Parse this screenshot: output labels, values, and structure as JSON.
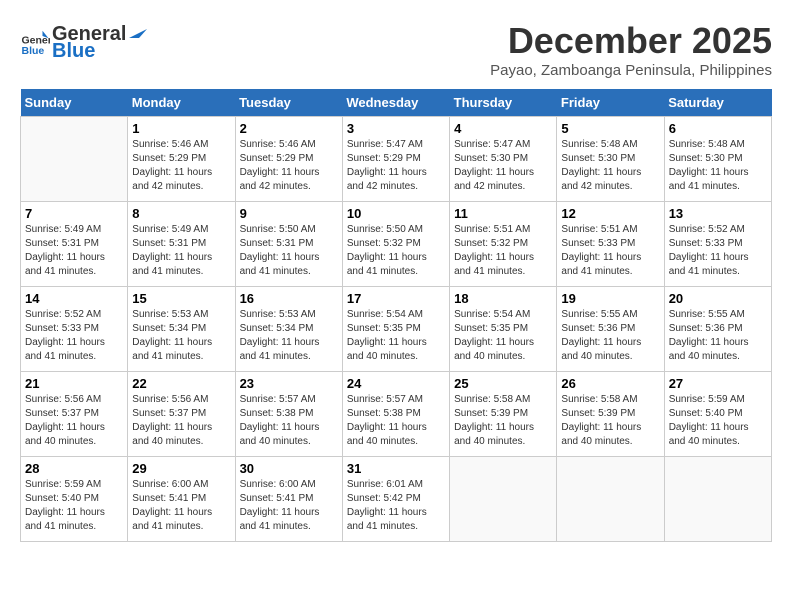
{
  "header": {
    "logo_general": "General",
    "logo_blue": "Blue",
    "month_year": "December 2025",
    "location": "Payao, Zamboanga Peninsula, Philippines"
  },
  "days_of_week": [
    "Sunday",
    "Monday",
    "Tuesday",
    "Wednesday",
    "Thursday",
    "Friday",
    "Saturday"
  ],
  "weeks": [
    {
      "days": [
        {
          "number": "",
          "sunrise": "",
          "sunset": "",
          "daylight": ""
        },
        {
          "number": "1",
          "sunrise": "Sunrise: 5:46 AM",
          "sunset": "Sunset: 5:29 PM",
          "daylight": "Daylight: 11 hours and 42 minutes."
        },
        {
          "number": "2",
          "sunrise": "Sunrise: 5:46 AM",
          "sunset": "Sunset: 5:29 PM",
          "daylight": "Daylight: 11 hours and 42 minutes."
        },
        {
          "number": "3",
          "sunrise": "Sunrise: 5:47 AM",
          "sunset": "Sunset: 5:29 PM",
          "daylight": "Daylight: 11 hours and 42 minutes."
        },
        {
          "number": "4",
          "sunrise": "Sunrise: 5:47 AM",
          "sunset": "Sunset: 5:30 PM",
          "daylight": "Daylight: 11 hours and 42 minutes."
        },
        {
          "number": "5",
          "sunrise": "Sunrise: 5:48 AM",
          "sunset": "Sunset: 5:30 PM",
          "daylight": "Daylight: 11 hours and 42 minutes."
        },
        {
          "number": "6",
          "sunrise": "Sunrise: 5:48 AM",
          "sunset": "Sunset: 5:30 PM",
          "daylight": "Daylight: 11 hours and 41 minutes."
        }
      ]
    },
    {
      "days": [
        {
          "number": "7",
          "sunrise": "Sunrise: 5:49 AM",
          "sunset": "Sunset: 5:31 PM",
          "daylight": "Daylight: 11 hours and 41 minutes."
        },
        {
          "number": "8",
          "sunrise": "Sunrise: 5:49 AM",
          "sunset": "Sunset: 5:31 PM",
          "daylight": "Daylight: 11 hours and 41 minutes."
        },
        {
          "number": "9",
          "sunrise": "Sunrise: 5:50 AM",
          "sunset": "Sunset: 5:31 PM",
          "daylight": "Daylight: 11 hours and 41 minutes."
        },
        {
          "number": "10",
          "sunrise": "Sunrise: 5:50 AM",
          "sunset": "Sunset: 5:32 PM",
          "daylight": "Daylight: 11 hours and 41 minutes."
        },
        {
          "number": "11",
          "sunrise": "Sunrise: 5:51 AM",
          "sunset": "Sunset: 5:32 PM",
          "daylight": "Daylight: 11 hours and 41 minutes."
        },
        {
          "number": "12",
          "sunrise": "Sunrise: 5:51 AM",
          "sunset": "Sunset: 5:33 PM",
          "daylight": "Daylight: 11 hours and 41 minutes."
        },
        {
          "number": "13",
          "sunrise": "Sunrise: 5:52 AM",
          "sunset": "Sunset: 5:33 PM",
          "daylight": "Daylight: 11 hours and 41 minutes."
        }
      ]
    },
    {
      "days": [
        {
          "number": "14",
          "sunrise": "Sunrise: 5:52 AM",
          "sunset": "Sunset: 5:33 PM",
          "daylight": "Daylight: 11 hours and 41 minutes."
        },
        {
          "number": "15",
          "sunrise": "Sunrise: 5:53 AM",
          "sunset": "Sunset: 5:34 PM",
          "daylight": "Daylight: 11 hours and 41 minutes."
        },
        {
          "number": "16",
          "sunrise": "Sunrise: 5:53 AM",
          "sunset": "Sunset: 5:34 PM",
          "daylight": "Daylight: 11 hours and 41 minutes."
        },
        {
          "number": "17",
          "sunrise": "Sunrise: 5:54 AM",
          "sunset": "Sunset: 5:35 PM",
          "daylight": "Daylight: 11 hours and 40 minutes."
        },
        {
          "number": "18",
          "sunrise": "Sunrise: 5:54 AM",
          "sunset": "Sunset: 5:35 PM",
          "daylight": "Daylight: 11 hours and 40 minutes."
        },
        {
          "number": "19",
          "sunrise": "Sunrise: 5:55 AM",
          "sunset": "Sunset: 5:36 PM",
          "daylight": "Daylight: 11 hours and 40 minutes."
        },
        {
          "number": "20",
          "sunrise": "Sunrise: 5:55 AM",
          "sunset": "Sunset: 5:36 PM",
          "daylight": "Daylight: 11 hours and 40 minutes."
        }
      ]
    },
    {
      "days": [
        {
          "number": "21",
          "sunrise": "Sunrise: 5:56 AM",
          "sunset": "Sunset: 5:37 PM",
          "daylight": "Daylight: 11 hours and 40 minutes."
        },
        {
          "number": "22",
          "sunrise": "Sunrise: 5:56 AM",
          "sunset": "Sunset: 5:37 PM",
          "daylight": "Daylight: 11 hours and 40 minutes."
        },
        {
          "number": "23",
          "sunrise": "Sunrise: 5:57 AM",
          "sunset": "Sunset: 5:38 PM",
          "daylight": "Daylight: 11 hours and 40 minutes."
        },
        {
          "number": "24",
          "sunrise": "Sunrise: 5:57 AM",
          "sunset": "Sunset: 5:38 PM",
          "daylight": "Daylight: 11 hours and 40 minutes."
        },
        {
          "number": "25",
          "sunrise": "Sunrise: 5:58 AM",
          "sunset": "Sunset: 5:39 PM",
          "daylight": "Daylight: 11 hours and 40 minutes."
        },
        {
          "number": "26",
          "sunrise": "Sunrise: 5:58 AM",
          "sunset": "Sunset: 5:39 PM",
          "daylight": "Daylight: 11 hours and 40 minutes."
        },
        {
          "number": "27",
          "sunrise": "Sunrise: 5:59 AM",
          "sunset": "Sunset: 5:40 PM",
          "daylight": "Daylight: 11 hours and 40 minutes."
        }
      ]
    },
    {
      "days": [
        {
          "number": "28",
          "sunrise": "Sunrise: 5:59 AM",
          "sunset": "Sunset: 5:40 PM",
          "daylight": "Daylight: 11 hours and 41 minutes."
        },
        {
          "number": "29",
          "sunrise": "Sunrise: 6:00 AM",
          "sunset": "Sunset: 5:41 PM",
          "daylight": "Daylight: 11 hours and 41 minutes."
        },
        {
          "number": "30",
          "sunrise": "Sunrise: 6:00 AM",
          "sunset": "Sunset: 5:41 PM",
          "daylight": "Daylight: 11 hours and 41 minutes."
        },
        {
          "number": "31",
          "sunrise": "Sunrise: 6:01 AM",
          "sunset": "Sunset: 5:42 PM",
          "daylight": "Daylight: 11 hours and 41 minutes."
        },
        {
          "number": "",
          "sunrise": "",
          "sunset": "",
          "daylight": ""
        },
        {
          "number": "",
          "sunrise": "",
          "sunset": "",
          "daylight": ""
        },
        {
          "number": "",
          "sunrise": "",
          "sunset": "",
          "daylight": ""
        }
      ]
    }
  ]
}
